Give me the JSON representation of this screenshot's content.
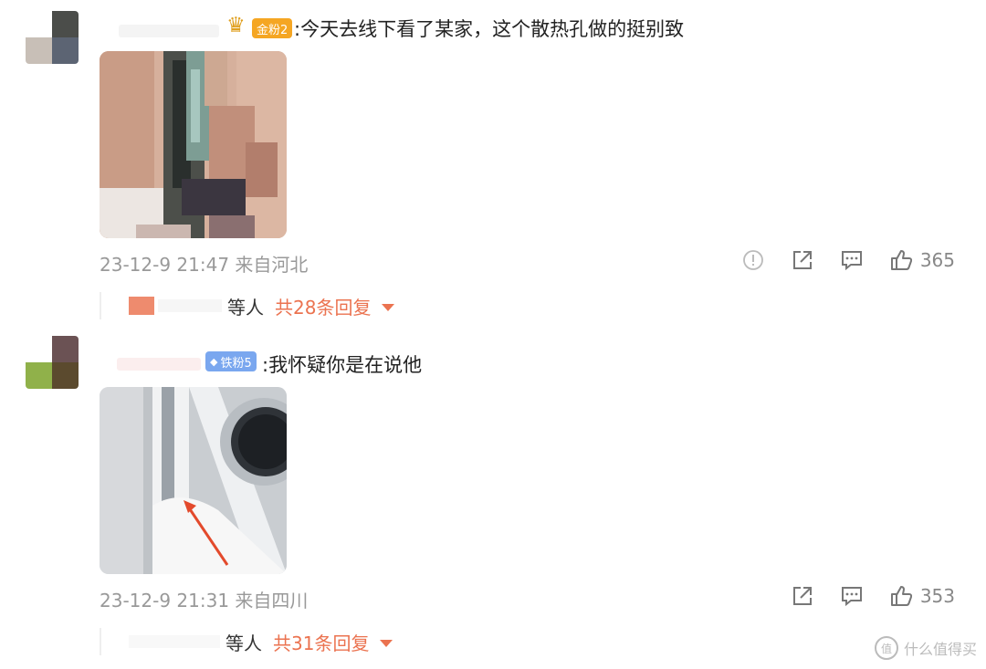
{
  "comments": [
    {
      "badge": "金粉2",
      "text": ":今天去线下看了某家，这个散热孔做的挺别致",
      "meta": "23-12-9 21:47 来自河北",
      "likes": "365",
      "replies_users": "等人",
      "replies_count": "共28条回复"
    },
    {
      "badge": "铁粉5",
      "text": ":我怀疑你是在说他",
      "meta": "23-12-9 21:31 来自四川",
      "likes": "353",
      "replies_users": "等人",
      "replies_count": "共31条回复"
    }
  ],
  "watermark": "什么值得买",
  "colors": {
    "accent": "#eb7350",
    "meta_gray": "#999999",
    "gold_badge": "#f5a623",
    "iron_badge": "#7aa7ef"
  },
  "icons": [
    "report-icon",
    "share-icon",
    "comment-icon",
    "like-icon",
    "caret-down-icon"
  ]
}
